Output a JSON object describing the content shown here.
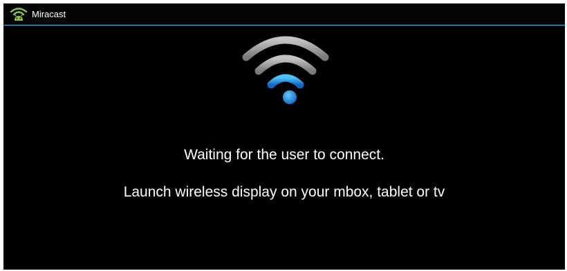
{
  "header": {
    "title": "Miracast",
    "icon": "android-wifi-icon"
  },
  "status": {
    "icon": "wifi-signal-icon",
    "primary_message": "Waiting for the user to connect.",
    "secondary_message": "Launch wireless display on your mbox, tablet or tv"
  },
  "colors": {
    "accent": "#33b5e5",
    "icon_green": "#8bc34a",
    "wifi_active": "#1e90d6",
    "wifi_inactive": "#9a9a9a",
    "background": "#000000",
    "text": "#ffffff"
  }
}
